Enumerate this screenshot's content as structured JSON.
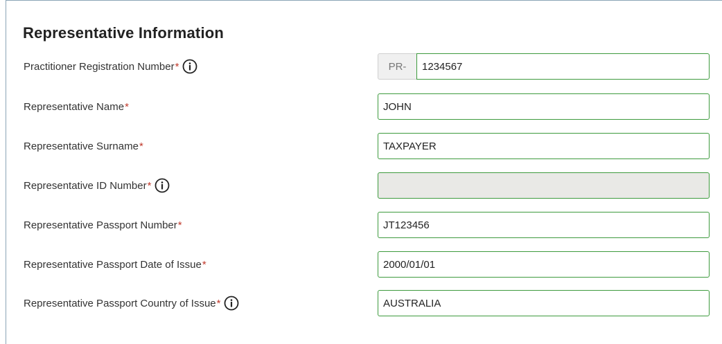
{
  "section": {
    "title": "Representative Information"
  },
  "required_mark": "*",
  "fields": {
    "practitioner_registration": {
      "label": "Practitioner Registration Number",
      "prefix": "PR-",
      "value": "1234567"
    },
    "name": {
      "label": "Representative Name",
      "value": "JOHN"
    },
    "surname": {
      "label": "Representative Surname",
      "value": "TAXPAYER"
    },
    "id_number": {
      "label": "Representative ID Number",
      "value": ""
    },
    "passport_number": {
      "label": "Representative Passport Number",
      "value": "JT123456"
    },
    "passport_date_of_issue": {
      "label": "Representative Passport Date of Issue",
      "value": "2000/01/01"
    },
    "passport_country_of_issue": {
      "label": "Representative Passport Country of Issue",
      "value": "AUSTRALIA"
    }
  },
  "icons": {
    "info": "info-circle-icon"
  },
  "colors": {
    "field_border": "#3d9a3d",
    "required": "#c0392b",
    "disabled_bg": "#e9e9e6"
  }
}
